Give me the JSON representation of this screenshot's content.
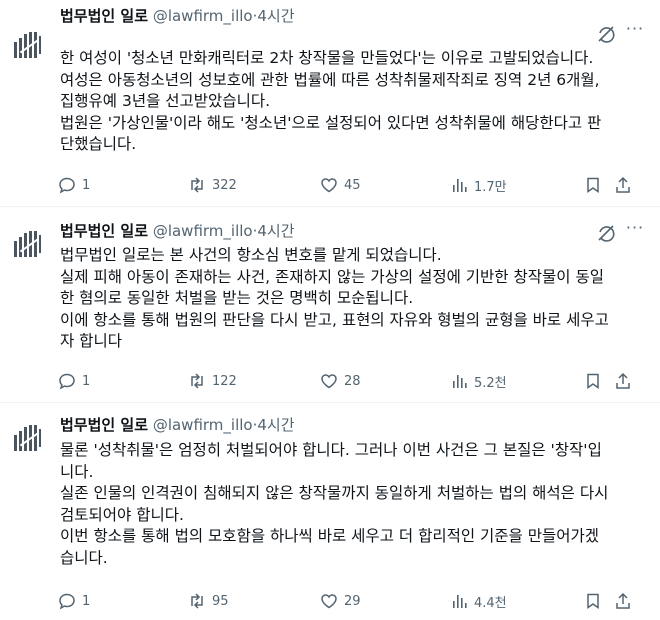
{
  "tweets": [
    {
      "author": "법무법인 일로",
      "handle": "@lawfirm_illo",
      "dot": "·",
      "time": "4시간",
      "lines": [
        "한 여성이 '청소년 만화캐릭터로 2차 창작물을 만들었다'는 이유로 고발되었습니다.",
        "여성은 아동청소년의 성보호에 관한 법률에 따른 성착취물제작죄로 징역 2년 6개월,",
        "집행유예 3년을 선고받았습니다.",
        "법원은 '가상인물'이라 해도 '청소년'으로 설정되어 있다면 성착취물에 해당한다고 판",
        "단했습니다."
      ],
      "replies": "1",
      "reposts": "322",
      "likes": "45",
      "views": "1.7만"
    },
    {
      "author": "법무법인 일로",
      "handle": "@lawfirm_illo",
      "dot": "·",
      "time": "4시간",
      "lines": [
        "법무법인 일로는 본 사건의 항소심 변호를 맡게 되었습니다.",
        "실제 피해 아동이 존재하는 사건, 존재하지 않는 가상의 설정에 기반한 창작물이 동일",
        "한 혐의로 동일한 처벌을 받는 것은 명백히 모순됩니다.",
        "이에 항소를 통해 법원의 판단을 다시 받고, 표현의 자유와 형벌의 균형을 바로 세우고",
        "자 합니다"
      ],
      "replies": "1",
      "reposts": "122",
      "likes": "28",
      "views": "5.2천"
    },
    {
      "author": "법무법인 일로",
      "handle": "@lawfirm_illo",
      "dot": "·",
      "time": "4시간",
      "lines": [
        "물론 '성착취물'은 엄정히 처벌되어야 합니다. 그러나 이번 사건은 그 본질은 '창작'입",
        "니다.",
        "실존 인물의 인격권이 침해되지 않은 창작물까지 동일하게 처벌하는 법의 해석은 다시",
        "검토되어야 합니다.",
        "이번 항소를 통해 법의 모호함을 하나씩 바로 세우고 더 합리적인 기준을 만들어가겠",
        "습니다."
      ],
      "replies": "1",
      "reposts": "95",
      "likes": "29",
      "views": "4.4천"
    }
  ],
  "icons": {
    "reply": "reply-icon",
    "repost": "repost-icon",
    "like": "heart-icon",
    "views": "views-icon",
    "bookmark": "bookmark-icon",
    "share": "share-icon",
    "grok": "grok-icon",
    "more": "more-icon"
  },
  "colors": {
    "text": "#0f1419",
    "secondary": "#536471",
    "divider": "#eff3f4"
  }
}
